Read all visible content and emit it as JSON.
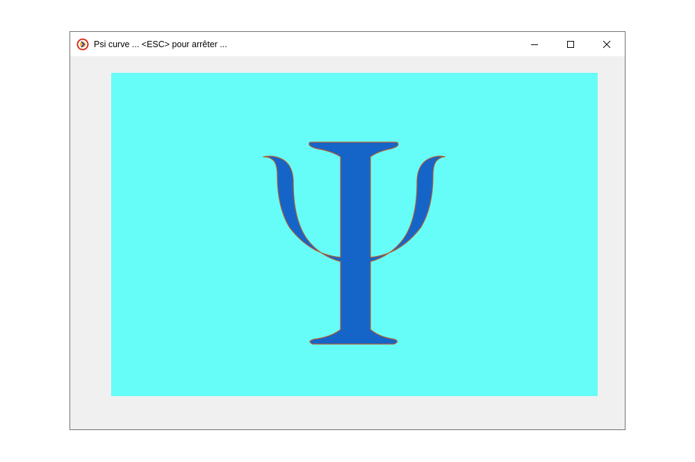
{
  "window": {
    "title": "Psi curve ... <ESC> pour arrêter ...",
    "icon": "app-icon",
    "controls": {
      "minimize_icon": "minimize-icon",
      "maximize_icon": "maximize-icon",
      "close_icon": "close-icon"
    }
  },
  "canvas": {
    "background_color": "#66fdf8",
    "glyph_fill_color": "#1565c8",
    "glyph_outline_color": "#b85a2e",
    "window_frame_color": "#f0f0f0"
  }
}
